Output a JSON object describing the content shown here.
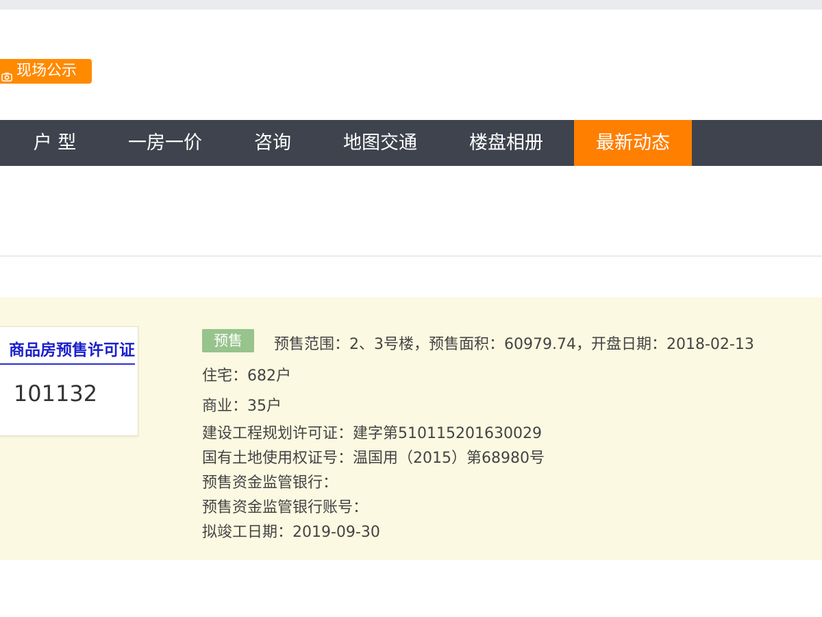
{
  "badge": {
    "icon": "camera-icon",
    "label": "现场公示",
    "color": "#ff8a00"
  },
  "nav": {
    "items": [
      {
        "label": "户 型",
        "active": false
      },
      {
        "label": "一房一价",
        "active": false
      },
      {
        "label": "咨询",
        "active": false
      },
      {
        "label": "地图交通",
        "active": false
      },
      {
        "label": "楼盘相册",
        "active": false
      },
      {
        "label": "最新动态",
        "active": true
      }
    ],
    "background": "#3e434d",
    "active_color": "#ff7f00"
  },
  "permit": {
    "title": "商品房预售许可证",
    "number": "101132"
  },
  "presale": {
    "tag": "预售",
    "summary": "预售范围：2、3号楼，预售面积：60979.74，开盘日期：2018-02-13",
    "residential": "住宅：682户",
    "commercial": "商业：35户",
    "planning_permit": "建设工程规划许可证：建字第510115201630029",
    "land_certificate": "国有土地使用权证号：温国用（2015）第68980号",
    "supervising_bank": "预售资金监管银行：",
    "supervising_account": "预售资金监管银行账号：",
    "completion_date": "拟竣工日期：2019-09-30"
  }
}
